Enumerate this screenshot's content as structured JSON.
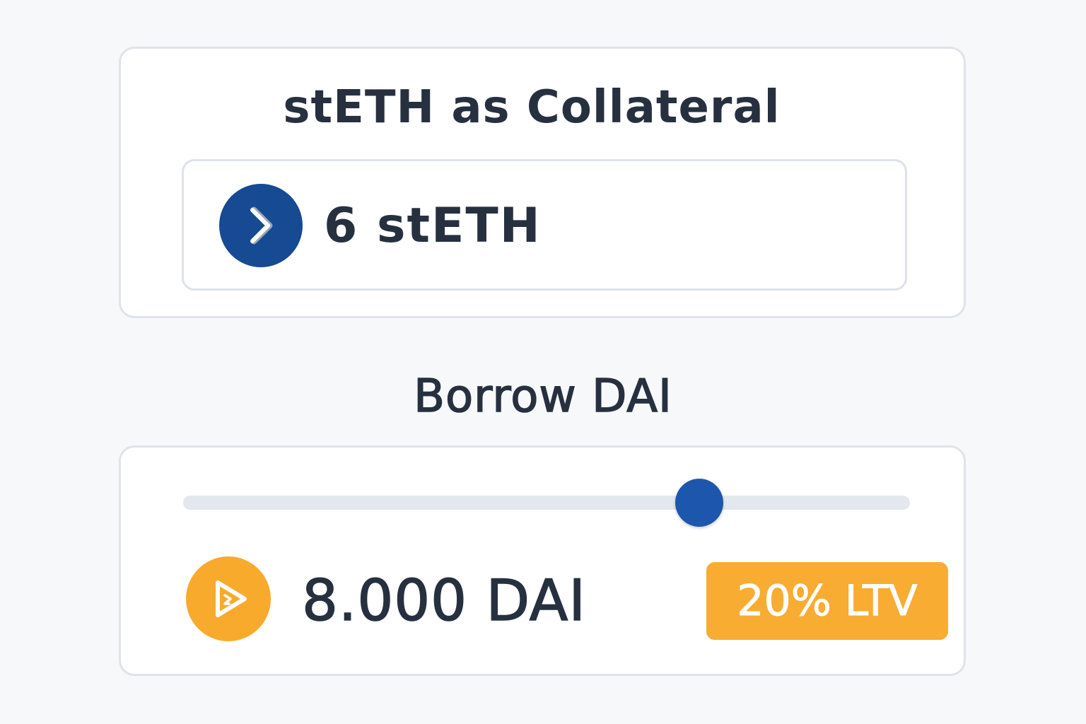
{
  "collateral": {
    "title": "stETH as Collateral",
    "amount": "6 stETH",
    "icon": "steth-chevron-icon",
    "icon_color": "#164a92"
  },
  "borrow": {
    "title": "Borrow DAI",
    "slider_level": 0.71,
    "amount": "8.000 DAI",
    "icon": "dai-play-icon",
    "icon_color": "#f8aa2c",
    "ltv_badge": "20% LTV",
    "badge_color": "#f8ac32",
    "accent_color": "#1d56ad"
  }
}
